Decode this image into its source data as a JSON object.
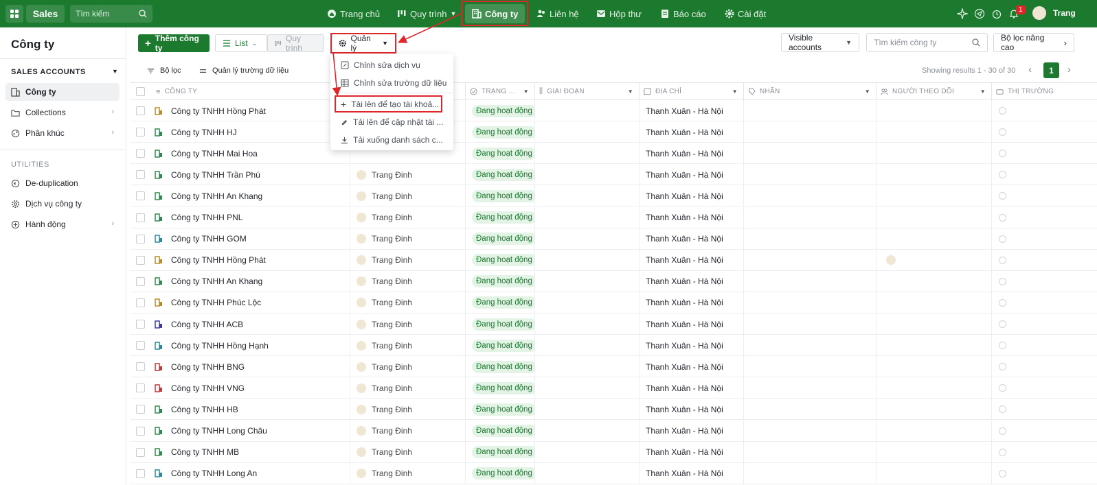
{
  "topbar": {
    "app_name": "Sales",
    "search_placeholder": "Tìm kiếm",
    "nav": [
      "Trang chủ",
      "Quy trình",
      "Công ty",
      "Liên hệ",
      "Hộp thư",
      "Báo cáo",
      "Cài đặt"
    ],
    "notification_count": "1",
    "user_name": "Trang"
  },
  "sidebar": {
    "title": "Công ty",
    "section_sales": "SALES ACCOUNTS",
    "items": [
      "Công ty",
      "Collections",
      "Phân khúc"
    ],
    "section_utilities": "UTILITIES",
    "util_items": [
      "De-duplication",
      "Dịch vụ công ty",
      "Hành động"
    ]
  },
  "toolbar": {
    "add_label": "Thêm công ty",
    "view_list": "List",
    "view_process": "Quy trình",
    "manage_label": "Quản lý",
    "visible_accounts": "Visible accounts",
    "search_placeholder": "Tìm kiếm công ty",
    "advanced_filter": "Bộ lọc nâng cao",
    "filter_label": "Bộ lọc",
    "manage_fields_label": "Quản lý trường dữ liệu",
    "showing": "Showing results 1 - 30 of 30",
    "page": "1"
  },
  "dropdown": {
    "items": [
      "Chỉnh sửa dịch vụ",
      "Chỉnh sửa trường dữ liệu",
      "Tải lên để tạo tài khoả...",
      "Tải lên để cập nhật tài ...",
      "Tải xuống danh sách c..."
    ]
  },
  "table": {
    "columns": [
      "CÔNG TY",
      "TRẠNG ...",
      "GIAI ĐOẠN",
      "ĐỊA CHỈ",
      "NHÃN",
      "NGƯỜI THEO DÕI",
      "THỊ TRƯỜNG"
    ],
    "rows": [
      {
        "company": "Công ty TNHH Hồng Phát",
        "owner": "",
        "status": "Đang hoạt động",
        "address": "Thanh Xuân - Hà Nội",
        "icon_color": "#b98a2a"
      },
      {
        "company": "Công ty TNHH HJ",
        "owner": "",
        "status": "Đang hoạt động",
        "address": "Thanh Xuân - Hà Nội",
        "icon_color": "#2e8a4f"
      },
      {
        "company": "Công ty TNHH Mai Hoa",
        "owner": "",
        "status": "Đang hoạt động",
        "address": "Thanh Xuân - Hà Nội",
        "icon_color": "#2e8a4f"
      },
      {
        "company": "Công ty TNHH Trần Phú",
        "owner": "Trang Đinh",
        "status": "Đang hoạt động",
        "address": "Thanh Xuân - Hà Nội",
        "icon_color": "#2e8a4f"
      },
      {
        "company": "Công ty TNHH An Khang",
        "owner": "Trang Đinh",
        "status": "Đang hoạt động",
        "address": "Thanh Xuân - Hà Nội",
        "icon_color": "#2e8a4f"
      },
      {
        "company": "Công ty TNHH PNL",
        "owner": "Trang Đinh",
        "status": "Đang hoạt động",
        "address": "Thanh Xuân - Hà Nội",
        "icon_color": "#2e8a4f"
      },
      {
        "company": "Công ty TNHH GOM",
        "owner": "Trang Đinh",
        "status": "Đang hoạt động",
        "address": "Thanh Xuân - Hà Nội",
        "icon_color": "#2a8a9a"
      },
      {
        "company": "Công ty TNHH Hồng Phát",
        "owner": "Trang Đinh",
        "status": "Đang hoạt động",
        "address": "Thanh Xuân - Hà Nội",
        "icon_color": "#b98a2a"
      },
      {
        "company": "Công ty TNHH An Khang",
        "owner": "Trang Đinh",
        "status": "Đang hoạt động",
        "address": "Thanh Xuân - Hà Nội",
        "icon_color": "#2e8a4f"
      },
      {
        "company": "Công ty TNHH Phúc Lộc",
        "owner": "Trang Đinh",
        "status": "Đang hoạt động",
        "address": "Thanh Xuân - Hà Nội",
        "icon_color": "#b98a2a"
      },
      {
        "company": "Công ty TNHH ACB",
        "owner": "Trang Đinh",
        "status": "Đang hoạt động",
        "address": "Thanh Xuân - Hà Nội",
        "icon_color": "#3a3aa0"
      },
      {
        "company": "Công ty TNHH Hồng Hạnh",
        "owner": "Trang Đinh",
        "status": "Đang hoạt động",
        "address": "Thanh Xuân - Hà Nội",
        "icon_color": "#2a8a9a"
      },
      {
        "company": "Công ty TNHH BNG",
        "owner": "Trang Đinh",
        "status": "Đang hoạt động",
        "address": "Thanh Xuân - Hà Nội",
        "icon_color": "#c0393b"
      },
      {
        "company": "Công ty TNHH VNG",
        "owner": "Trang Đinh",
        "status": "Đang hoạt động",
        "address": "Thanh Xuân - Hà Nội",
        "icon_color": "#c0393b"
      },
      {
        "company": "Công ty TNHH HB",
        "owner": "Trang Đinh",
        "status": "Đang hoạt động",
        "address": "Thanh Xuân - Hà Nội",
        "icon_color": "#2e8a4f"
      },
      {
        "company": "Công ty TNHH Long Châu",
        "owner": "Trang Đinh",
        "status": "Đang hoạt động",
        "address": "Thanh Xuân - Hà Nội",
        "icon_color": "#2e8a4f"
      },
      {
        "company": "Công ty TNHH MB",
        "owner": "Trang Đinh",
        "status": "Đang hoạt động",
        "address": "Thanh Xuân - Hà Nội",
        "icon_color": "#2e8a4f"
      },
      {
        "company": "Công ty TNHH Long An",
        "owner": "Trang Đinh",
        "status": "Đang hoạt động",
        "address": "Thanh Xuân - Hà Nội",
        "icon_color": "#2a8a9a"
      }
    ]
  },
  "colors": {
    "brand": "#1b7a2e",
    "highlight": "#e0262b"
  }
}
